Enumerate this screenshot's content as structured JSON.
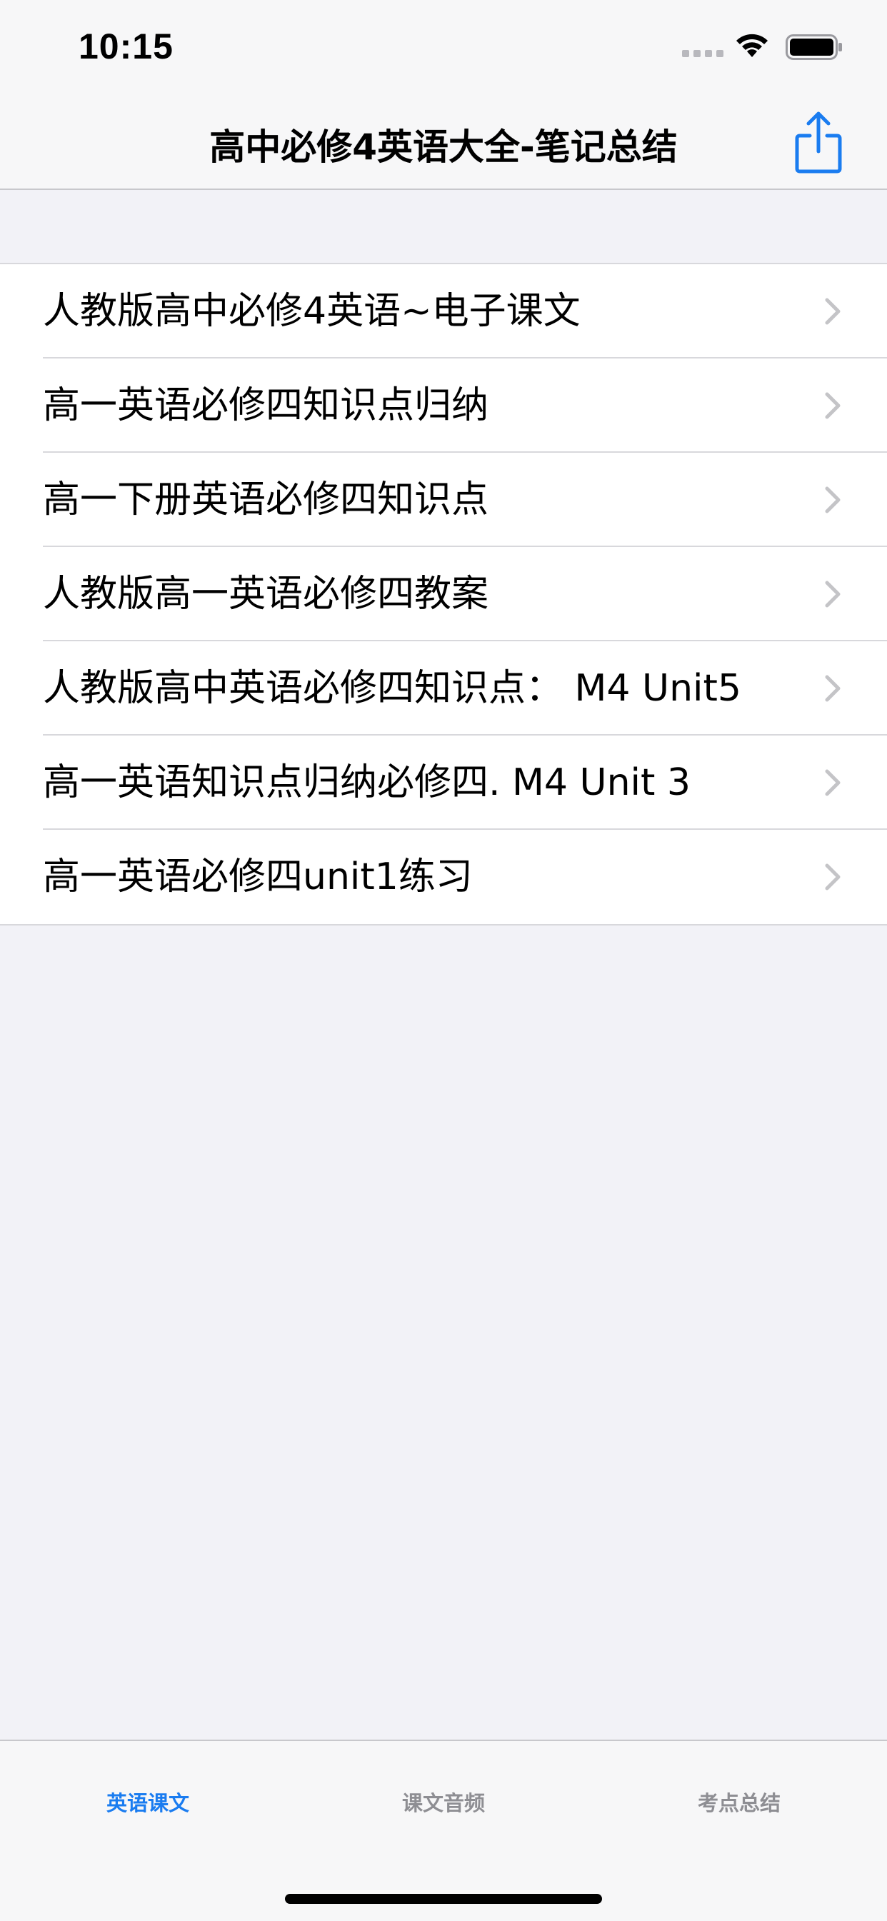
{
  "status_bar": {
    "time": "10:15"
  },
  "nav": {
    "title": "高中必修4英语大全-笔记总结",
    "share_icon": "share-icon",
    "accent": "#1a7cf0"
  },
  "list": {
    "items": [
      {
        "label": "人教版高中必修4英语~电子课文"
      },
      {
        "label": "高一英语必修四知识点归纳"
      },
      {
        "label": "高一下册英语必修四知识点"
      },
      {
        "label": "人教版高一英语必修四教案"
      },
      {
        "label": "人教版高中英语必修四知识点： M4 Unit5"
      },
      {
        "label": "高一英语知识点归纳必修四. M4 Unit 3"
      },
      {
        "label": "高一英语必修四unit1练习"
      }
    ]
  },
  "tabs": [
    {
      "label": "英语课文",
      "selected": true
    },
    {
      "label": "课文音频",
      "selected": false
    },
    {
      "label": "考点总结",
      "selected": false
    }
  ]
}
